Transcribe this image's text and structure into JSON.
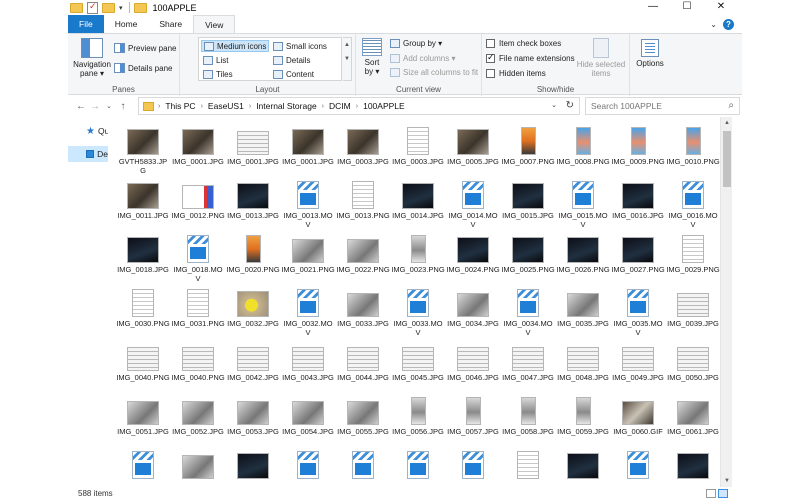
{
  "window": {
    "title": "100APPLE",
    "controls": {
      "minimize": "—",
      "maximize": "☐",
      "close": "✕"
    }
  },
  "ribbon": {
    "tabs": [
      {
        "label": "File"
      },
      {
        "label": "Home"
      },
      {
        "label": "Share"
      },
      {
        "label": "View"
      }
    ],
    "groups": {
      "panes": {
        "label": "Panes",
        "navigation_pane": "Navigation pane ▾",
        "preview_pane": "Preview pane",
        "details_pane": "Details pane"
      },
      "layout": {
        "label": "Layout",
        "options": [
          "Medium icons",
          "Small icons",
          "List",
          "Details",
          "Tiles",
          "Content"
        ],
        "selected": "Medium icons"
      },
      "current_view": {
        "label": "Current view",
        "sort_by": "Sort by ▾",
        "group_by": "Group by ▾",
        "add_columns": "Add columns ▾",
        "size_all_columns": "Size all columns to fit"
      },
      "show_hide": {
        "label": "Show/hide",
        "item_check_boxes": {
          "label": "Item check boxes",
          "checked": false
        },
        "file_name_extensions": {
          "label": "File name extensions",
          "checked": true
        },
        "hidden_items": {
          "label": "Hidden items",
          "checked": false
        },
        "hide_selected_items": "Hide selected items"
      },
      "options": {
        "label": "Options"
      }
    }
  },
  "address_bar": {
    "path": [
      "This PC",
      "EaseUS1",
      "Internal Storage",
      "DCIM",
      "100APPLE"
    ],
    "search_placeholder": "Search 100APPLE"
  },
  "nav_pane": {
    "items": [
      {
        "label": "Qu",
        "icon": "star-icon"
      },
      {
        "label": "De",
        "icon": "computer-icon"
      }
    ]
  },
  "files": [
    {
      "name": "GVTH5833.JPG",
      "thumb": "photo"
    },
    {
      "name": "IMG_0001.JPG",
      "thumb": "photo"
    },
    {
      "name": "IMG_0001.JPG",
      "thumb": "screen"
    },
    {
      "name": "IMG_0001.JPG",
      "thumb": "photo"
    },
    {
      "name": "IMG_0003.JPG",
      "thumb": "photo"
    },
    {
      "name": "IMG_0003.JPG",
      "thumb": "doc"
    },
    {
      "name": "IMG_0005.JPG",
      "thumb": "photo"
    },
    {
      "name": "IMG_0007.PNG",
      "thumb": "phone"
    },
    {
      "name": "IMG_0008.PNG",
      "thumb": "ios"
    },
    {
      "name": "IMG_0009.PNG",
      "thumb": "ios"
    },
    {
      "name": "IMG_0010.PNG",
      "thumb": "ios"
    },
    {
      "name": "IMG_0011.JPG",
      "thumb": "photo"
    },
    {
      "name": "IMG_0012.PNG",
      "thumb": "flag"
    },
    {
      "name": "IMG_0013.JPG",
      "thumb": "dark"
    },
    {
      "name": "IMG_0013.MOV",
      "thumb": "video"
    },
    {
      "name": "IMG_0013.PNG",
      "thumb": "doc"
    },
    {
      "name": "IMG_0014.JPG",
      "thumb": "dark"
    },
    {
      "name": "IMG_0014.MOV",
      "thumb": "video"
    },
    {
      "name": "IMG_0015.JPG",
      "thumb": "dark"
    },
    {
      "name": "IMG_0015.MOV",
      "thumb": "video"
    },
    {
      "name": "IMG_0016.JPG",
      "thumb": "dark"
    },
    {
      "name": "IMG_0016.MOV",
      "thumb": "video"
    },
    {
      "name": "IMG_0018.JPG",
      "thumb": "dark"
    },
    {
      "name": "IMG_0018.MOV",
      "thumb": "video"
    },
    {
      "name": "IMG_0020.PNG",
      "thumb": "phone"
    },
    {
      "name": "IMG_0021.PNG",
      "thumb": "gray"
    },
    {
      "name": "IMG_0022.PNG",
      "thumb": "gray"
    },
    {
      "name": "IMG_0023.PNG",
      "thumb": "hand"
    },
    {
      "name": "IMG_0024.PNG",
      "thumb": "dark"
    },
    {
      "name": "IMG_0025.PNG",
      "thumb": "dark"
    },
    {
      "name": "IMG_0026.PNG",
      "thumb": "dark"
    },
    {
      "name": "IMG_0027.PNG",
      "thumb": "dark"
    },
    {
      "name": "IMG_0029.PNG",
      "thumb": "doc"
    },
    {
      "name": "IMG_0030.PNG",
      "thumb": "doc"
    },
    {
      "name": "IMG_0031.PNG",
      "thumb": "doc"
    },
    {
      "name": "IMG_0032.JPG",
      "thumb": "yellow"
    },
    {
      "name": "IMG_0032.MOV",
      "thumb": "video"
    },
    {
      "name": "IMG_0033.JPG",
      "thumb": "gray"
    },
    {
      "name": "IMG_0033.MOV",
      "thumb": "video"
    },
    {
      "name": "IMG_0034.JPG",
      "thumb": "gray"
    },
    {
      "name": "IMG_0034.MOV",
      "thumb": "video"
    },
    {
      "name": "IMG_0035.JPG",
      "thumb": "gray"
    },
    {
      "name": "IMG_0035.MOV",
      "thumb": "video"
    },
    {
      "name": "IMG_0039.JPG",
      "thumb": "screen"
    },
    {
      "name": "IMG_0040.PNG",
      "thumb": "screen"
    },
    {
      "name": "IMG_0040.PNG",
      "thumb": "screen"
    },
    {
      "name": "IMG_0042.JPG",
      "thumb": "screen"
    },
    {
      "name": "IMG_0043.JPG",
      "thumb": "screen"
    },
    {
      "name": "IMG_0044.JPG",
      "thumb": "screen"
    },
    {
      "name": "IMG_0045.JPG",
      "thumb": "screen"
    },
    {
      "name": "IMG_0046.JPG",
      "thumb": "screen"
    },
    {
      "name": "IMG_0047.JPG",
      "thumb": "screen"
    },
    {
      "name": "IMG_0048.JPG",
      "thumb": "screen"
    },
    {
      "name": "IMG_0049.JPG",
      "thumb": "screen"
    },
    {
      "name": "IMG_0050.JPG",
      "thumb": "screen"
    },
    {
      "name": "IMG_0051.JPG",
      "thumb": "gray"
    },
    {
      "name": "IMG_0052.JPG",
      "thumb": "gray"
    },
    {
      "name": "IMG_0053.JPG",
      "thumb": "gray"
    },
    {
      "name": "IMG_0054.JPG",
      "thumb": "gray"
    },
    {
      "name": "IMG_0055.JPG",
      "thumb": "gray"
    },
    {
      "name": "IMG_0056.JPG",
      "thumb": "hand"
    },
    {
      "name": "IMG_0057.JPG",
      "thumb": "hand"
    },
    {
      "name": "IMG_0058.JPG",
      "thumb": "hand"
    },
    {
      "name": "IMG_0059.JPG",
      "thumb": "hand"
    },
    {
      "name": "IMG_0060.GIF",
      "thumb": "gif"
    },
    {
      "name": "IMG_0061.JPG",
      "thumb": "gray"
    },
    {
      "name": "",
      "thumb": "video"
    },
    {
      "name": "",
      "thumb": "gray"
    },
    {
      "name": "",
      "thumb": "dark"
    },
    {
      "name": "",
      "thumb": "video"
    },
    {
      "name": "",
      "thumb": "video"
    },
    {
      "name": "",
      "thumb": "video"
    },
    {
      "name": "",
      "thumb": "video"
    },
    {
      "name": "",
      "thumb": "doc"
    },
    {
      "name": "",
      "thumb": "dark"
    },
    {
      "name": "",
      "thumb": "video"
    },
    {
      "name": "",
      "thumb": "dark"
    }
  ],
  "status_bar": {
    "item_count": "588 items"
  },
  "colors": {
    "accent": "#1979ca",
    "selection": "#cce4f7"
  }
}
